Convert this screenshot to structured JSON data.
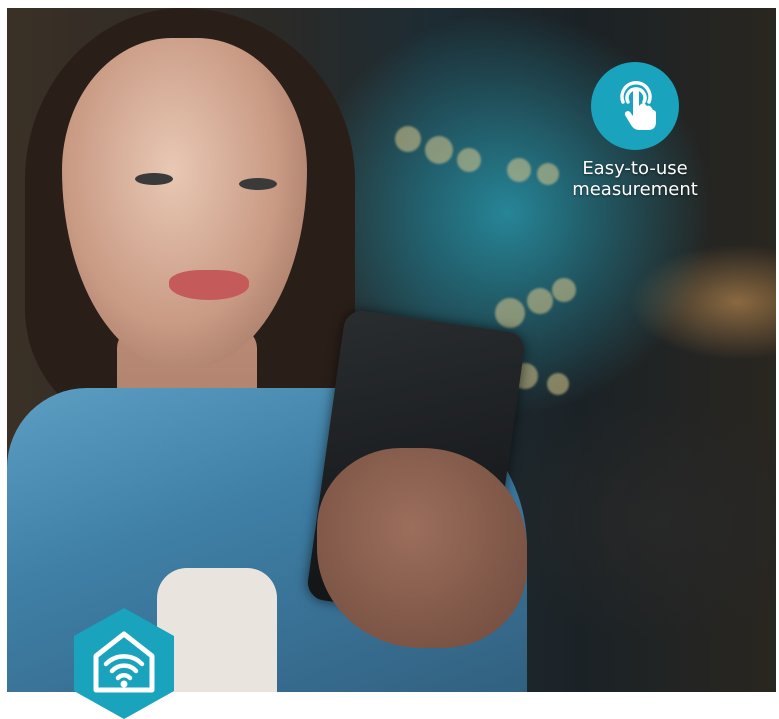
{
  "features": [
    {
      "icon": "touch-hand-icon",
      "label_line1": "Easy-to-use",
      "label_line2": "measurement"
    }
  ],
  "brand_badge": {
    "icon": "smart-home-wifi-icon",
    "color": "#19a3bd"
  },
  "colors": {
    "accent": "#19a3bd",
    "text_on_photo": "#ffffff"
  }
}
